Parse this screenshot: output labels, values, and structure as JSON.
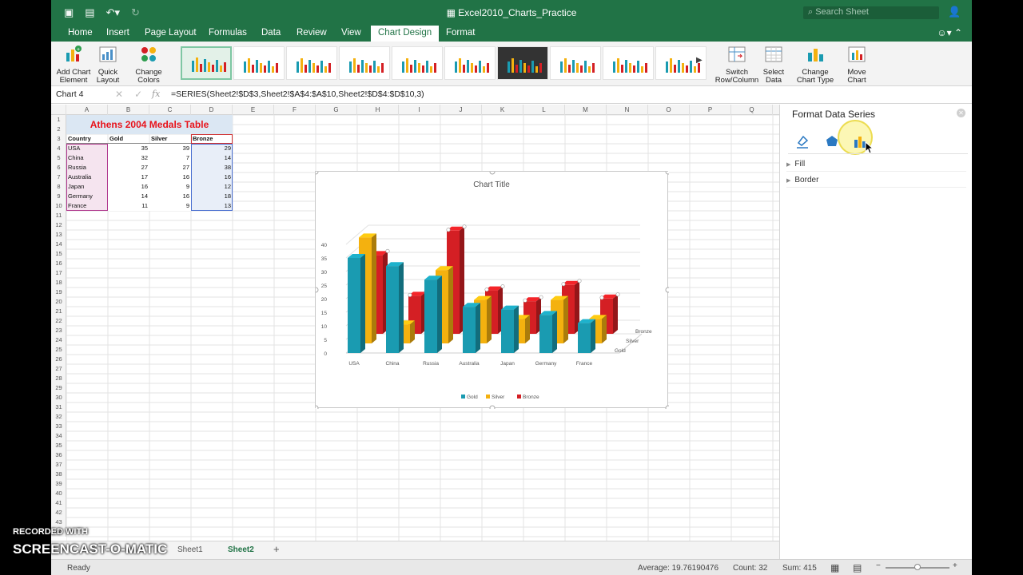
{
  "app": {
    "doc_title": "Excel2010_Charts_Practice",
    "search_placeholder": "Search Sheet"
  },
  "tabs": [
    "Home",
    "Insert",
    "Page Layout",
    "Formulas",
    "Data",
    "Review",
    "View",
    "Chart Design",
    "Format"
  ],
  "active_tab": "Chart Design",
  "ribbon": {
    "add_chart_element": [
      "Add Chart",
      "Element"
    ],
    "quick_layout": [
      "Quick",
      "Layout"
    ],
    "change_colors": [
      "Change",
      "Colors"
    ],
    "switch_row_column": [
      "Switch",
      "Row/Column"
    ],
    "select_data": [
      "Select",
      "Data"
    ],
    "change_chart_type": [
      "Change",
      "Chart Type"
    ],
    "move_chart": [
      "Move",
      "Chart"
    ]
  },
  "formula_bar": {
    "name_box": "Chart 4",
    "formula": "=SERIES(Sheet2!$D$3,Sheet2!$A$4:$A$10,Sheet2!$D$4:$D$10,3)"
  },
  "columns": [
    "A",
    "B",
    "C",
    "D",
    "E",
    "F",
    "G",
    "H",
    "I",
    "J",
    "K",
    "L",
    "M",
    "N",
    "O",
    "P",
    "Q"
  ],
  "table": {
    "title": "Athens 2004 Medals Table",
    "headers": [
      "Country",
      "Gold",
      "Silver",
      "Bronze"
    ],
    "rows": [
      [
        "USA",
        35,
        39,
        29
      ],
      [
        "China",
        32,
        7,
        14
      ],
      [
        "Russia",
        27,
        27,
        38
      ],
      [
        "Australia",
        17,
        16,
        16
      ],
      [
        "Japan",
        16,
        9,
        12
      ],
      [
        "Germany",
        14,
        16,
        18
      ],
      [
        "France",
        11,
        9,
        13
      ]
    ]
  },
  "chart_data": {
    "type": "bar",
    "title": "Chart Title",
    "categories": [
      "USA",
      "China",
      "Russia",
      "Australia",
      "Japan",
      "Germany",
      "France"
    ],
    "series": [
      {
        "name": "Gold",
        "values": [
          35,
          32,
          27,
          17,
          16,
          14,
          11
        ],
        "color": "#1a9bb1"
      },
      {
        "name": "Silver",
        "values": [
          39,
          7,
          27,
          16,
          9,
          16,
          9
        ],
        "color": "#f4b10f"
      },
      {
        "name": "Bronze",
        "values": [
          29,
          14,
          38,
          16,
          12,
          18,
          13
        ],
        "color": "#d41f24"
      }
    ],
    "yticks": [
      "0",
      "5",
      "10",
      "15",
      "20",
      "25",
      "30",
      "35",
      "40"
    ],
    "ylim": [
      0,
      40
    ],
    "depth_labels": [
      "Bronze",
      "Silver",
      "Gold"
    ],
    "legend_position": "bottom",
    "gridlines": true
  },
  "pane": {
    "title": "Format Data Series",
    "sections": [
      "Fill",
      "Border"
    ]
  },
  "sheet_tabs": [
    "Sheet1",
    "Sheet2"
  ],
  "active_sheet": "Sheet2",
  "status": {
    "ready": "Ready",
    "average": "Average: 19.76190476",
    "count": "Count: 32",
    "sum": "Sum: 415"
  },
  "watermark": {
    "line1": "RECORDED WITH",
    "line2": "SCREENCAST-O-MATIC"
  },
  "colors": {
    "excel_green": "#217346",
    "gold": "#1a9bb1",
    "silver": "#f4b10f",
    "bronze": "#d41f24",
    "title_red": "#e8131b"
  }
}
